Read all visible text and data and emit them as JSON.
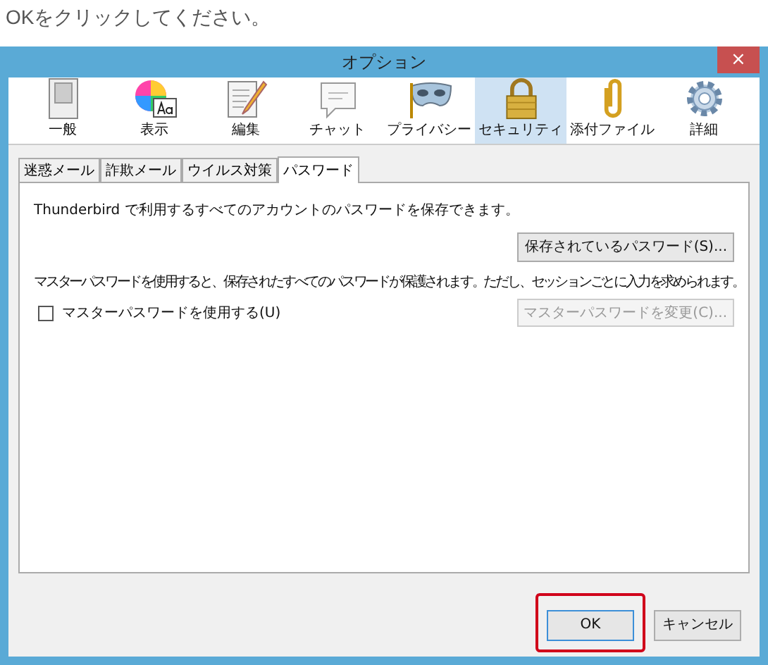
{
  "instruction": "OKをクリックしてください。",
  "window": {
    "title": "オプション",
    "close": "×"
  },
  "toolbar": [
    {
      "label": "一般",
      "kind": "general",
      "selected": false
    },
    {
      "label": "表示",
      "kind": "display",
      "selected": false
    },
    {
      "label": "編集",
      "kind": "edit",
      "selected": false
    },
    {
      "label": "チャット",
      "kind": "chat",
      "selected": false
    },
    {
      "label": "プライバシー",
      "kind": "privacy",
      "selected": false
    },
    {
      "label": "セキュリティ",
      "kind": "security",
      "selected": true
    },
    {
      "label": "添付ファイル",
      "kind": "attach",
      "selected": false
    },
    {
      "label": "詳細",
      "kind": "advanced",
      "selected": false
    }
  ],
  "tabs": [
    {
      "label": "迷惑メール",
      "selected": false
    },
    {
      "label": "詐欺メール",
      "selected": false
    },
    {
      "label": "ウイルス対策",
      "selected": false
    },
    {
      "label": "パスワード",
      "selected": true
    }
  ],
  "panel": {
    "description": "Thunderbird で利用するすべてのアカウントのパスワードを保存できます。",
    "saved_button": {
      "label": "保存されているパスワード(S)...",
      "disabled": false
    },
    "master_description": "マスターパスワードを使用すると、保存されたすべてのパスワードが保護されます。ただし、セッションごとに入力を求められます。",
    "master_checkbox": {
      "label": "マスターパスワードを使用する(U)",
      "checked": false
    },
    "change_button": {
      "label": "マスターパスワードを変更(C)...",
      "disabled": true
    }
  },
  "buttons": [
    {
      "label": "OK",
      "highlighted": true
    },
    {
      "label": "キャンセル",
      "highlighted": false
    }
  ]
}
